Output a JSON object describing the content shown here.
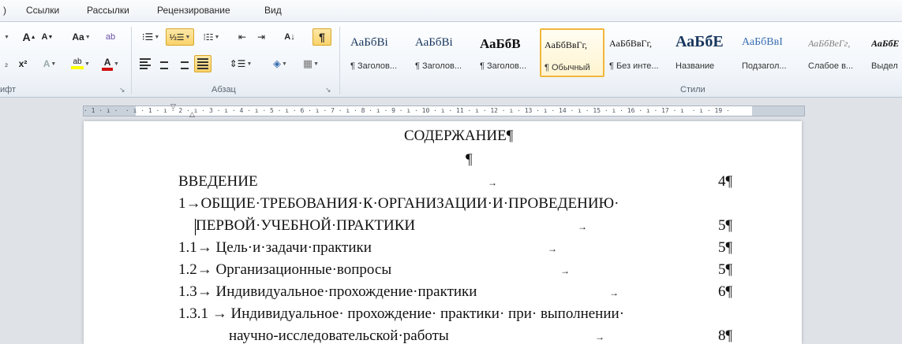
{
  "tabs": [
    "Ссылки",
    "Рассылки",
    "Рецензирование",
    "Вид"
  ],
  "ribbon": {
    "groups": {
      "font": "ифт",
      "paragraph": "Абзац",
      "styles": "Стили"
    },
    "font": {
      "grow": "A",
      "shrink": "A",
      "case": "Aa",
      "sub": "₂",
      "sup": "x²",
      "effects": "A",
      "highlight": "ab",
      "color": "A"
    },
    "colors": {
      "highlight": "#ffff00",
      "font": "#d11111",
      "accent": "#f9d26a"
    }
  },
  "styles": [
    {
      "sample": "АаБбВі",
      "name": "¶ Заголов...",
      "bold": false
    },
    {
      "sample": "АаБбВі",
      "name": "¶ Заголов...",
      "bold": false
    },
    {
      "sample": "АаБбВ",
      "name": "¶ Заголов...",
      "bold": true
    },
    {
      "sample": "АаБбВвГг,",
      "name": "¶ Обычный",
      "bold": false,
      "selected": true
    },
    {
      "sample": "АаБбВвГг,",
      "name": "¶ Без инте...",
      "bold": false
    },
    {
      "sample": "АаБбЕ",
      "name": "Название",
      "bold": true
    },
    {
      "sample": "АаБбВвІ",
      "name": "Подзагол...",
      "bold": false
    },
    {
      "sample": "АаБбВеГг,",
      "name": "Слабое в...",
      "bold": false,
      "italic": true
    },
    {
      "sample": "АаБбЕ",
      "name": "Выдел",
      "bold": false,
      "italic": true
    }
  ],
  "ruler": {
    "text": "· 1 · ı ·  · ı · 1 · ı · 2 · ı · 3 · ı · 4 · ı · 5 · ı · 6 · ı · 7 · ı · 8 · ı · 9 · ı · 10 · ı · 11 · ı · 12 · ı · 13 · ı · 14 · ı · 15 · ı · 16 · ı · 17 · ı  · ı · 19 ·"
  },
  "document": {
    "title": "СОДЕРЖАНИЕ¶",
    "blank": "¶",
    "arrow": "→",
    "toc": [
      {
        "text": "ВВЕДЕНИЕ",
        "page": "4¶"
      },
      {
        "text": "1→ОБЩИЕ·ТРЕБОВАНИЯ·К·ОРГАНИЗАЦИИ·И·ПРОВЕДЕНИЮ·",
        "page": ""
      },
      {
        "text": "ПЕРВОЙ·УЧЕБНОЙ·ПРАКТИКИ",
        "page": "5¶"
      },
      {
        "text": "1.1→ Цель·и·задачи·практики",
        "page": "5¶"
      },
      {
        "text": "1.2→ Организационные·вопросы",
        "page": "5¶"
      },
      {
        "text": "1.3→ Индивидуальное·прохождение·практики",
        "page": "6¶"
      },
      {
        "text": "1.3.1 → Индивидуальное· прохождение· практики· при· выполнении·",
        "page": ""
      },
      {
        "text": "научно-исследовательской·работы",
        "page": "8¶"
      }
    ]
  }
}
